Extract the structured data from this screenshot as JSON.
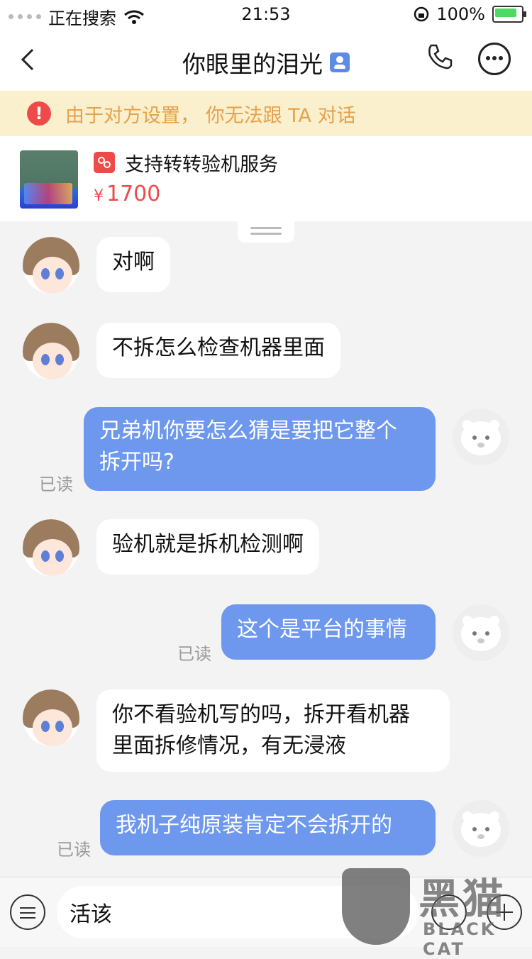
{
  "status_bar": {
    "carrier": "正在搜索",
    "time": "21:53",
    "battery": "100%"
  },
  "header": {
    "title": "你眼里的泪光"
  },
  "notice": {
    "text": "由于对方设置， 你无法跟 TA 对话"
  },
  "product": {
    "title": "支持转转验机服务",
    "currency": "¥",
    "price": "1700"
  },
  "messages": [
    {
      "side": "in",
      "text": "对啊"
    },
    {
      "side": "in",
      "text": "不拆怎么检查机器里面"
    },
    {
      "side": "out",
      "line1": "兄弟机你要怎么猜是要把它整个",
      "line2": "拆开吗?",
      "status": "已读"
    },
    {
      "side": "in",
      "text": "验机就是拆机检测啊"
    },
    {
      "side": "out",
      "text": "这个是平台的事情",
      "status": "已读"
    },
    {
      "side": "in",
      "line1": "你不看验机写的吗，拆开看机器",
      "line2": "里面拆修情况，有无浸液"
    },
    {
      "side": "out",
      "text": "我机子纯原装肯定不会拆开的",
      "status": "已读"
    }
  ],
  "input": {
    "value": "活该"
  },
  "watermark": {
    "cn": "黑猫",
    "en": "BLACK CAT"
  },
  "colors": {
    "accent": "#6e98ee",
    "price": "#ef4a4a",
    "notice_bg": "#fbf0cd",
    "notice_text": "#e7a14b"
  }
}
